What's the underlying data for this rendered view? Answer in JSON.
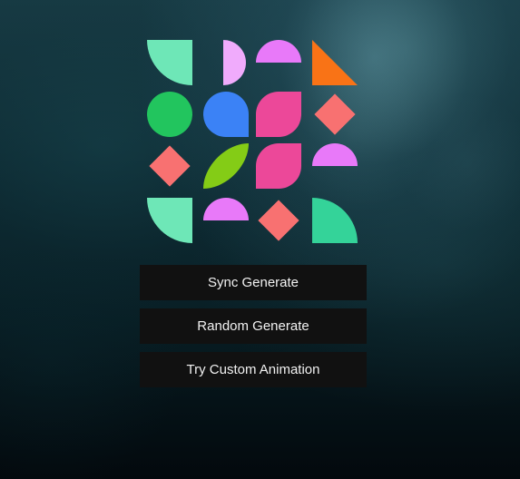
{
  "buttons": {
    "sync_generate": "Sync Generate",
    "random_generate": "Random Generate",
    "try_custom_animation": "Try Custom Animation"
  },
  "shapes": [
    {
      "name": "mint-quarter-round",
      "color": "#6ee7b7"
    },
    {
      "name": "lilac-half-circle-right",
      "color": "#f0abfc"
    },
    {
      "name": "magenta-half-circle-top",
      "color": "#e879f9"
    },
    {
      "name": "orange-triangle",
      "color": "#f97316"
    },
    {
      "name": "green-circle",
      "color": "#22c55e"
    },
    {
      "name": "blue-teardrop",
      "color": "#3b82f6"
    },
    {
      "name": "pink-leaf",
      "color": "#ec4899"
    },
    {
      "name": "coral-diamond",
      "color": "#f87171"
    },
    {
      "name": "coral-diamond",
      "color": "#f87171"
    },
    {
      "name": "lime-leaf",
      "color": "#84cc16"
    },
    {
      "name": "pink-leaf",
      "color": "#ec4899"
    },
    {
      "name": "magenta-half-circle-top",
      "color": "#e879f9"
    },
    {
      "name": "mint-quarter-round",
      "color": "#6ee7b7"
    },
    {
      "name": "magenta-half-circle-top",
      "color": "#e879f9"
    },
    {
      "name": "coral-diamond",
      "color": "#f87171"
    },
    {
      "name": "emerald-quarter-round",
      "color": "#34d399"
    }
  ]
}
